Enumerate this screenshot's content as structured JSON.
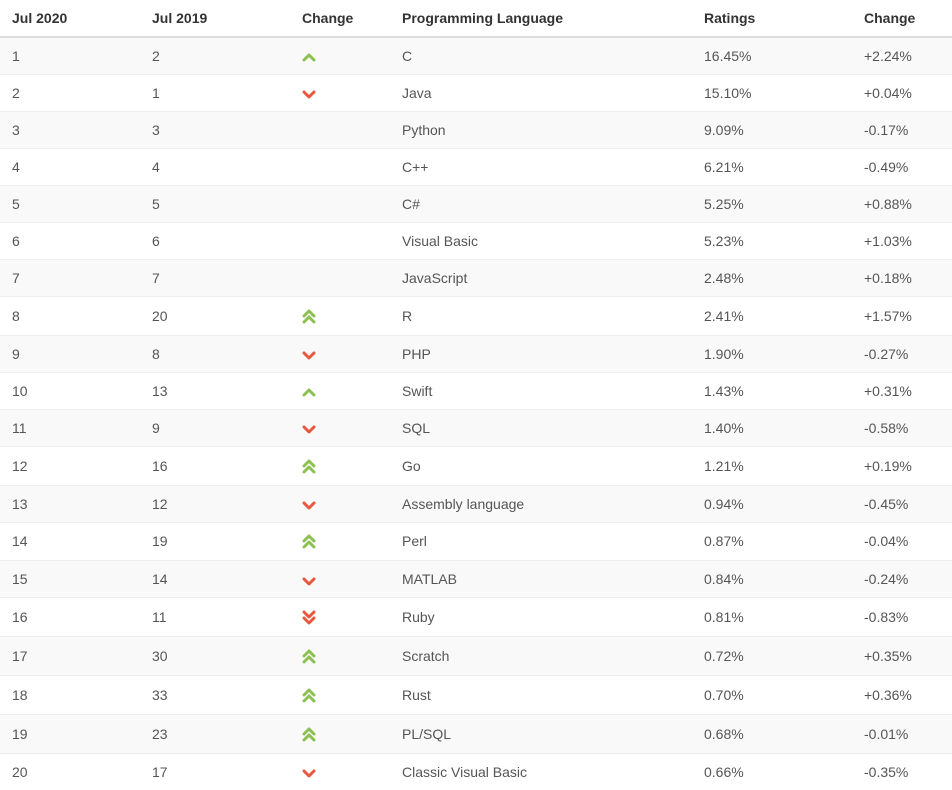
{
  "headers": {
    "jul2020": "Jul 2020",
    "jul2019": "Jul 2019",
    "change_icon": "Change",
    "language": "Programming Language",
    "ratings": "Ratings",
    "change_val": "Change"
  },
  "icons": {
    "up": "chevron-up-icon",
    "down": "chevron-down-icon",
    "double_up": "double-chevron-up-icon",
    "double_down": "double-chevron-down-icon",
    "none": ""
  },
  "colors": {
    "up": "#8cc152",
    "down": "#e9573f"
  },
  "rows": [
    {
      "jul2020": "1",
      "jul2019": "2",
      "change": "up",
      "language": "C",
      "ratings": "16.45%",
      "change_val": "+2.24%"
    },
    {
      "jul2020": "2",
      "jul2019": "1",
      "change": "down",
      "language": "Java",
      "ratings": "15.10%",
      "change_val": "+0.04%"
    },
    {
      "jul2020": "3",
      "jul2019": "3",
      "change": "none",
      "language": "Python",
      "ratings": "9.09%",
      "change_val": "-0.17%"
    },
    {
      "jul2020": "4",
      "jul2019": "4",
      "change": "none",
      "language": "C++",
      "ratings": "6.21%",
      "change_val": "-0.49%"
    },
    {
      "jul2020": "5",
      "jul2019": "5",
      "change": "none",
      "language": "C#",
      "ratings": "5.25%",
      "change_val": "+0.88%"
    },
    {
      "jul2020": "6",
      "jul2019": "6",
      "change": "none",
      "language": "Visual Basic",
      "ratings": "5.23%",
      "change_val": "+1.03%"
    },
    {
      "jul2020": "7",
      "jul2019": "7",
      "change": "none",
      "language": "JavaScript",
      "ratings": "2.48%",
      "change_val": "+0.18%"
    },
    {
      "jul2020": "8",
      "jul2019": "20",
      "change": "double_up",
      "language": "R",
      "ratings": "2.41%",
      "change_val": "+1.57%"
    },
    {
      "jul2020": "9",
      "jul2019": "8",
      "change": "down",
      "language": "PHP",
      "ratings": "1.90%",
      "change_val": "-0.27%"
    },
    {
      "jul2020": "10",
      "jul2019": "13",
      "change": "up",
      "language": "Swift",
      "ratings": "1.43%",
      "change_val": "+0.31%"
    },
    {
      "jul2020": "11",
      "jul2019": "9",
      "change": "down",
      "language": "SQL",
      "ratings": "1.40%",
      "change_val": "-0.58%"
    },
    {
      "jul2020": "12",
      "jul2019": "16",
      "change": "double_up",
      "language": "Go",
      "ratings": "1.21%",
      "change_val": "+0.19%"
    },
    {
      "jul2020": "13",
      "jul2019": "12",
      "change": "down",
      "language": "Assembly language",
      "ratings": "0.94%",
      "change_val": "-0.45%"
    },
    {
      "jul2020": "14",
      "jul2019": "19",
      "change": "double_up",
      "language": "Perl",
      "ratings": "0.87%",
      "change_val": "-0.04%"
    },
    {
      "jul2020": "15",
      "jul2019": "14",
      "change": "down",
      "language": "MATLAB",
      "ratings": "0.84%",
      "change_val": "-0.24%"
    },
    {
      "jul2020": "16",
      "jul2019": "11",
      "change": "double_down",
      "language": "Ruby",
      "ratings": "0.81%",
      "change_val": "-0.83%"
    },
    {
      "jul2020": "17",
      "jul2019": "30",
      "change": "double_up",
      "language": "Scratch",
      "ratings": "0.72%",
      "change_val": "+0.35%"
    },
    {
      "jul2020": "18",
      "jul2019": "33",
      "change": "double_up",
      "language": "Rust",
      "ratings": "0.70%",
      "change_val": "+0.36%"
    },
    {
      "jul2020": "19",
      "jul2019": "23",
      "change": "double_up",
      "language": "PL/SQL",
      "ratings": "0.68%",
      "change_val": "-0.01%"
    },
    {
      "jul2020": "20",
      "jul2019": "17",
      "change": "down",
      "language": "Classic Visual Basic",
      "ratings": "0.66%",
      "change_val": "-0.35%"
    }
  ]
}
